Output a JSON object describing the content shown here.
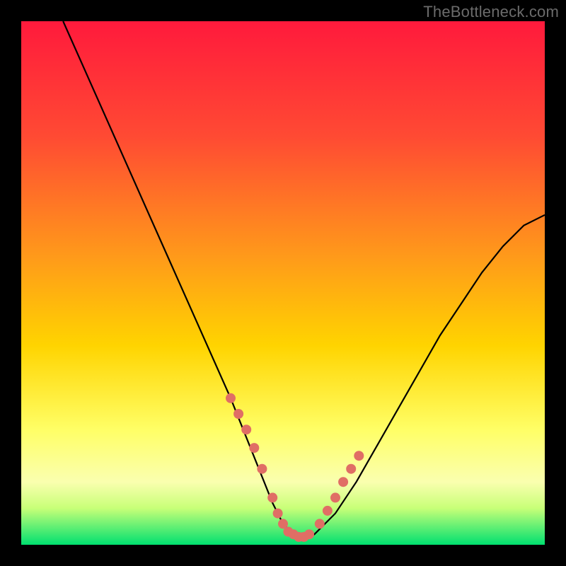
{
  "watermark": "TheBottleneck.com",
  "colors": {
    "frame": "#000000",
    "gradient_top": "#ff1a3c",
    "gradient_mid1": "#ff6a2a",
    "gradient_mid2": "#ffd400",
    "gradient_mid3": "#ffff66",
    "gradient_mid4": "#d8ff66",
    "gradient_bottom": "#00e070",
    "curve": "#000000",
    "dots": "#e06e65",
    "watermark": "#6b6b6b"
  },
  "chart_data": {
    "type": "line",
    "title": "",
    "xlabel": "",
    "ylabel": "",
    "xlim": [
      0,
      100
    ],
    "ylim": [
      0,
      100
    ],
    "series": [
      {
        "name": "bottleneck-curve",
        "x": [
          8,
          12,
          16,
          20,
          24,
          28,
          32,
          36,
          40,
          42,
          44,
          46,
          48,
          50,
          52,
          54,
          56,
          60,
          64,
          68,
          72,
          76,
          80,
          84,
          88,
          92,
          96,
          100
        ],
        "y": [
          100,
          91,
          82,
          73,
          64,
          55,
          46,
          37,
          28,
          23,
          18,
          13,
          8,
          4,
          2,
          1,
          2,
          6,
          12,
          19,
          26,
          33,
          40,
          46,
          52,
          57,
          61,
          63
        ]
      }
    ],
    "highlight_points": {
      "name": "highlighted-range",
      "x": [
        40,
        41.5,
        43,
        44.5,
        46,
        48,
        49,
        50,
        51,
        52,
        53,
        54,
        55,
        57,
        58.5,
        60,
        61.5,
        63,
        64.5
      ],
      "y": [
        28,
        25,
        22,
        18.5,
        14.5,
        9,
        6,
        4,
        2.5,
        2,
        1.5,
        1.5,
        2,
        4,
        6.5,
        9,
        12,
        14.5,
        17
      ]
    },
    "gradient_bands": [
      {
        "y0": 0,
        "y1": 4,
        "color": "#00e070"
      },
      {
        "y0": 4,
        "y1": 10,
        "color": "#d8ff66"
      },
      {
        "y0": 10,
        "y1": 30,
        "color": "#ffff66"
      },
      {
        "y0": 30,
        "y1": 60,
        "color": "#ffd400"
      },
      {
        "y0": 60,
        "y1": 85,
        "color": "#ff6a2a"
      },
      {
        "y0": 85,
        "y1": 100,
        "color": "#ff1a3c"
      }
    ]
  }
}
